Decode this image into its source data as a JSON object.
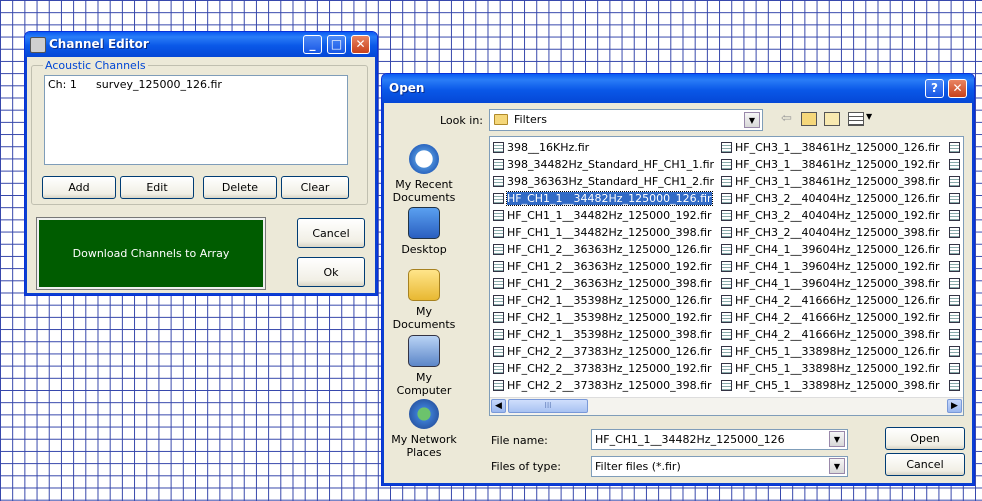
{
  "channel_editor": {
    "title": "Channel Editor",
    "group_label": "Acoustic Channels",
    "list_items": [
      {
        "ch": "Ch: 1",
        "file": "survey_125000_126.fir"
      }
    ],
    "buttons": {
      "add": "Add",
      "edit": "Edit",
      "delete": "Delete",
      "clear": "Clear",
      "download": "Download Channels to Array",
      "cancel": "Cancel",
      "ok": "Ok"
    },
    "colors": {
      "download_button": "#005c00"
    }
  },
  "open_dialog": {
    "title": "Open",
    "look_in_label": "Look in:",
    "look_in_value": "Filters",
    "places": [
      "My Recent Documents",
      "Desktop",
      "My Documents",
      "My Computer",
      "My Network Places"
    ],
    "files_col1": [
      "398__16KHz.fir",
      "398_34482Hz_Standard_HF_CH1_1.fir",
      "398_36363Hz_Standard_HF_CH1_2.fir",
      "HF_CH1_1__34482Hz_125000_126.fir",
      "HF_CH1_1__34482Hz_125000_192.fir",
      "HF_CH1_1__34482Hz_125000_398.fir",
      "HF_CH1_2__36363Hz_125000_126.fir",
      "HF_CH1_2__36363Hz_125000_192.fir",
      "HF_CH1_2__36363Hz_125000_398.fir",
      "HF_CH2_1__35398Hz_125000_126.fir",
      "HF_CH2_1__35398Hz_125000_192.fir",
      "HF_CH2_1__35398Hz_125000_398.fir",
      "HF_CH2_2__37383Hz_125000_126.fir",
      "HF_CH2_2__37383Hz_125000_192.fir",
      "HF_CH2_2__37383Hz_125000_398.fir"
    ],
    "files_col2": [
      "HF_CH3_1__38461Hz_125000_126.fir",
      "HF_CH3_1__38461Hz_125000_192.fir",
      "HF_CH3_1__38461Hz_125000_398.fir",
      "HF_CH3_2__40404Hz_125000_126.fir",
      "HF_CH3_2__40404Hz_125000_192.fir",
      "HF_CH3_2__40404Hz_125000_398.fir",
      "HF_CH4_1__39604Hz_125000_126.fir",
      "HF_CH4_1__39604Hz_125000_192.fir",
      "HF_CH4_1__39604Hz_125000_398.fir",
      "HF_CH4_2__41666Hz_125000_126.fir",
      "HF_CH4_2__41666Hz_125000_192.fir",
      "HF_CH4_2__41666Hz_125000_398.fir",
      "HF_CH5_1__33898Hz_125000_126.fir",
      "HF_CH5_1__33898Hz_125000_192.fir",
      "HF_CH5_1__33898Hz_125000_398.fir"
    ],
    "selected_index": 3,
    "scroll_thumb_glyph": "III",
    "file_name_label": "File name:",
    "file_name_value": "HF_CH1_1__34482Hz_125000_126",
    "file_type_label": "Files of type:",
    "file_type_value": "Filter files (*.fir)",
    "open_button": "Open",
    "cancel_button": "Cancel",
    "help_glyph": "?",
    "colors": {
      "title_bar": "#0a58e8",
      "selection": "#316ac5"
    }
  }
}
